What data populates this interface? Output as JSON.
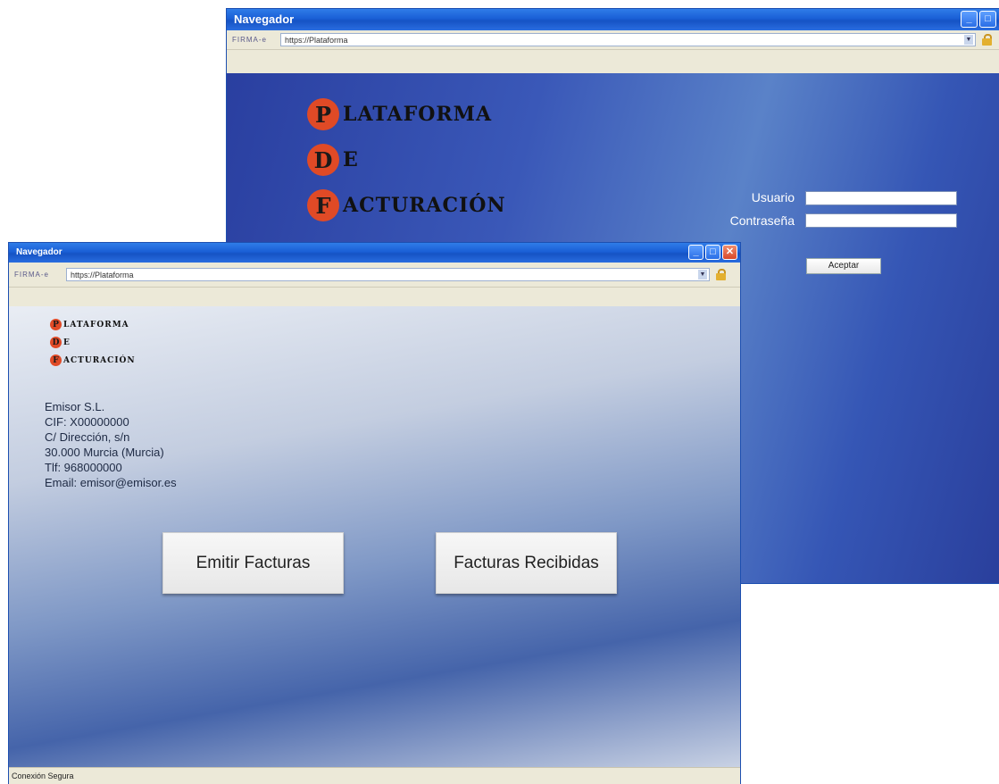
{
  "back_window": {
    "title": "Navegador",
    "brand": "FIRMA-e",
    "url": "https://Plataforma",
    "logo": {
      "line1_initial": "P",
      "line1_rest": "LATAFORMA",
      "line2_initial": "D",
      "line2_rest": "E",
      "line3_initial": "F",
      "line3_rest": "ACTURACIÓN"
    },
    "login": {
      "user_label": "Usuario",
      "password_label": "Contraseña",
      "accept_button": "Aceptar"
    }
  },
  "front_window": {
    "title": "Navegador",
    "brand": "FIRMA-e",
    "url": "https://Plataforma",
    "logo": {
      "line1_initial": "P",
      "line1_rest": "LATAFORMA",
      "line2_initial": "D",
      "line2_rest": "E",
      "line3_initial": "F",
      "line3_rest": "ACTURACIÓN"
    },
    "issuer": {
      "name": "Emisor S.L.",
      "cif": "CIF: X00000000",
      "address": "C/ Dirección, s/n",
      "city": "30.000 Murcia (Murcia)",
      "phone": "Tlf: 968000000",
      "email": "Email: emisor@emisor.es"
    },
    "actions": {
      "issue_invoices": "Emitir Facturas",
      "received_invoices": "Facturas Recibidas"
    },
    "status": "Conexión Segura"
  },
  "colors": {
    "titlebar": "#1a5fd6",
    "logo_circle": "#e04a26",
    "back_content": "#2a3fa0"
  }
}
